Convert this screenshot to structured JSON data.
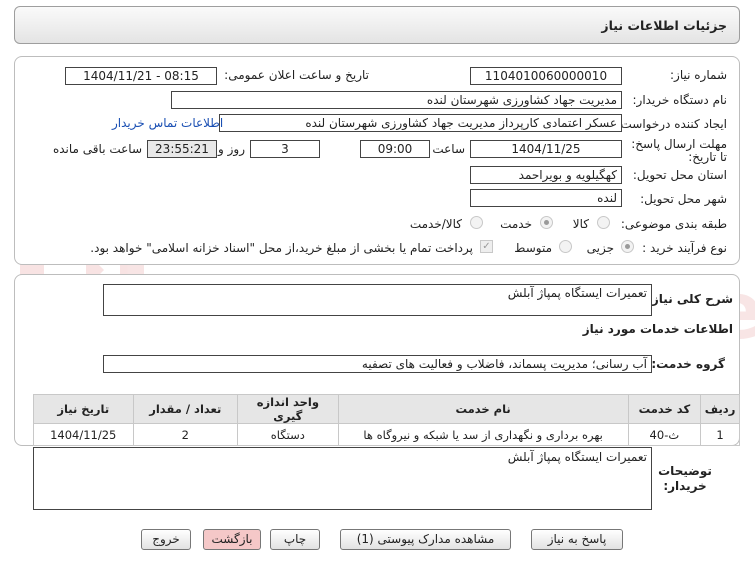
{
  "page_title": "جزئیات اطلاعات نیاز",
  "fields": {
    "need_number_label": "شماره نیاز:",
    "need_number": "1104010060000010",
    "announce_label": "تاریخ و ساعت اعلان عمومی:",
    "announce_value": "1404/11/21 - 08:15",
    "buyer_label": "نام دستگاه خریدار:",
    "buyer_value": "مدیریت جهاد کشاورزی شهرستان لنده",
    "creator_label": "ایجاد کننده درخواست:",
    "creator_value": "عسکر اعتمادی کارپرداز مدیریت جهاد کشاورزی شهرستان لنده",
    "contact_link": "اطلاعات تماس خریدار",
    "deadline_label": "مهلت ارسال پاسخ: تا تاریخ:",
    "deadline_date": "1404/11/25",
    "time_label": "ساعت",
    "deadline_time": "09:00",
    "days_value": "3",
    "days_label": "روز و",
    "remaining_value": "23:55:21",
    "remaining_label": "ساعت باقی مانده",
    "province_label": "استان محل تحویل:",
    "province_value": "کهگیلویه و بویراحمد",
    "city_label": "شهر محل تحویل:",
    "city_value": "لنده",
    "category_label": "طبقه بندی موضوعی:",
    "category_options": [
      "کالا",
      "خدمت",
      "کالا/خدمت"
    ],
    "category_selected": "خدمت",
    "process_label": "نوع فرآیند خرید :",
    "process_options": [
      "جزیی",
      "متوسط"
    ],
    "process_selected": "جزیی",
    "payment_note": "پرداخت تمام یا بخشی از مبلغ خرید،از محل \"اسناد خزانه اسلامی\" خواهد بود."
  },
  "summary": {
    "label": "شرح کلی نیاز:",
    "value": "تعمیرات ایستگاه پمپاژ آبلش"
  },
  "services": {
    "title": "اطلاعات خدمات مورد نیاز",
    "group_label": "گروه خدمت:",
    "group_value": "آب رسانی؛ مدیریت پسماند، فاضلاب و فعالیت های تصفیه",
    "headers": [
      "ردیف",
      "کد خدمت",
      "نام خدمت",
      "واحد اندازه گیری",
      "تعداد / مقدار",
      "تاریخ نیاز"
    ],
    "rows": [
      [
        "1",
        "ث-40",
        "بهره برداری و نگهداری از سد یا شبکه و نیروگاه ها",
        "دستگاه",
        "2",
        "1404/11/25"
      ]
    ]
  },
  "buyer_notes": {
    "label": "توضیحات خریدار:",
    "value": "تعمیرات ایستگاه پمپاژ آبلش"
  },
  "buttons": {
    "reply": "پاسخ به نیاز",
    "attachments": "مشاهده مدارک پیوستی (1)",
    "print": "چاپ",
    "back": "بازگشت",
    "exit": "خروج"
  },
  "watermark": "AriaTender.net",
  "colors": {
    "back_button": "#f5c8c8",
    "link": "#1a4fb3"
  }
}
